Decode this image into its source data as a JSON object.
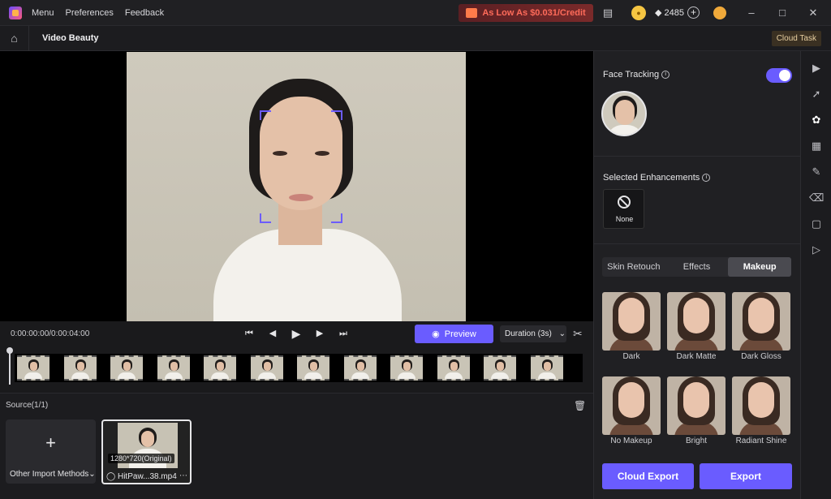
{
  "titlebar": {
    "menu": [
      "Menu",
      "Preferences",
      "Feedback"
    ],
    "promo": "As Low As $0.031/Credit",
    "credits": "2485"
  },
  "subheader": {
    "title": "Video Beauty",
    "cloud_task": "Cloud Task"
  },
  "controls": {
    "timecode": "0:00:00:00/0:00:04:00",
    "preview": "Preview",
    "duration": "Duration (3s)"
  },
  "timeline": {
    "frame_count": 12
  },
  "source": {
    "label": "Source(1/1)",
    "import_label": "Other Import Methods",
    "media": {
      "resolution": "1280*720(Original)",
      "filename": "HitPaw...38.mp4"
    }
  },
  "panel": {
    "face_tracking": "Face Tracking",
    "face_tracking_on": true,
    "selected_enhancements": "Selected Enhancements",
    "none_label": "None",
    "tabs": [
      "Skin Retouch",
      "Effects",
      "Makeup"
    ],
    "active_tab": "Makeup",
    "makeup_items": [
      "Dark",
      "Dark Matte",
      "Dark Gloss",
      "No Makeup",
      "Bright",
      "Radiant Shine"
    ],
    "cloud_export": "Cloud Export",
    "export": "Export"
  },
  "colors": {
    "accent": "#6a5cff",
    "promo_text": "#ff6b5a"
  },
  "icons": {
    "toolstrip": [
      "video-enhance-icon",
      "curve-icon",
      "face-beauty-icon",
      "grid-icon",
      "edit-icon",
      "eraser-icon",
      "crop-select-icon",
      "export-video-icon"
    ]
  }
}
